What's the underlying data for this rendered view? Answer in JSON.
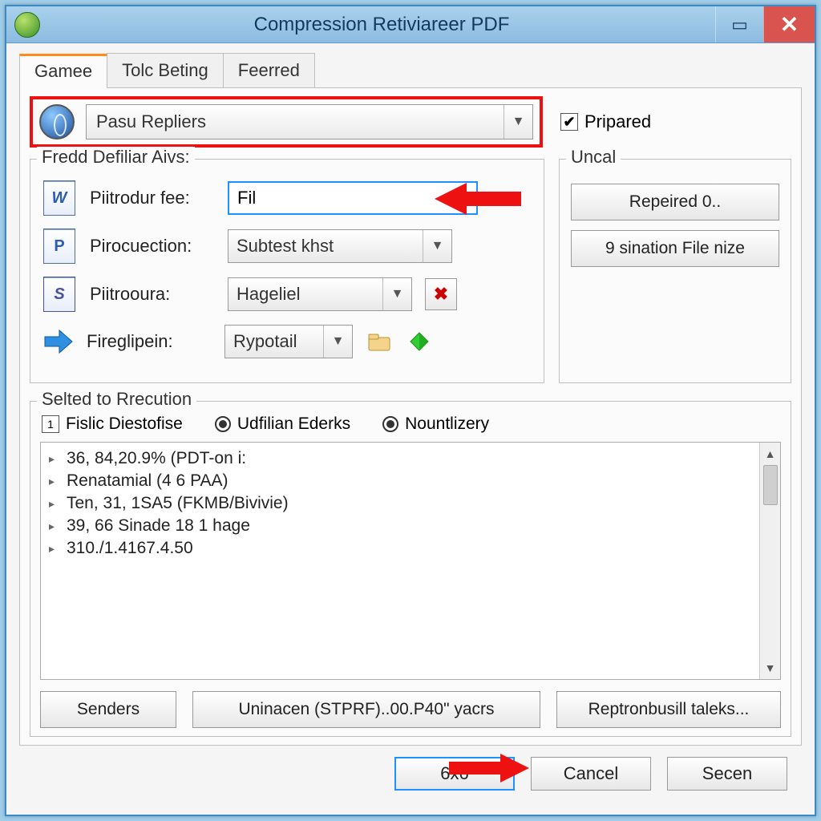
{
  "window": {
    "title": "Compression Retiviareer PDF"
  },
  "tabs": [
    "Gamee",
    "Tolc Beting",
    "Feerred"
  ],
  "preset": {
    "value": "Pasu Repliers",
    "prepared_label": "Pripared",
    "prepared_checked": true
  },
  "left_group": {
    "title": "Fredd Defiliar Aivs:",
    "rows": {
      "r1": {
        "label": "Piitrodur fee:",
        "value": "Fil"
      },
      "r2": {
        "label": "Pirocuection:",
        "value": "Subtest khst"
      },
      "r3": {
        "label": "Piitrooura:",
        "value": "Hageliel"
      },
      "r4": {
        "label": "Fireglipein:",
        "value": "Rypotail"
      }
    }
  },
  "right_group": {
    "title": "Uncal",
    "buttons": [
      "Repeired 0..",
      "9 sination File nize"
    ]
  },
  "lower_group": {
    "title": "Selted to Rrecution",
    "options": [
      "Fislic Diestofise",
      "Udfilian Ederks",
      "Nountlizery"
    ],
    "lines": [
      "36, 84,20.9% (PDT-on i:",
      "Renatamial (4 6 PAA)",
      "Ten, 31, 1SA5 (FKMB/Bivivie)",
      "39, 66 Sinade 18 1 hage",
      "310./1.4167.4.50"
    ],
    "buttons": [
      "Senders",
      "Uninacen (STPRF)..00.P40\" yacrs",
      "Reptronbusill taleks..."
    ]
  },
  "dialog": {
    "ok": "6x6",
    "cancel": "Cancel",
    "secen": "Secen"
  }
}
